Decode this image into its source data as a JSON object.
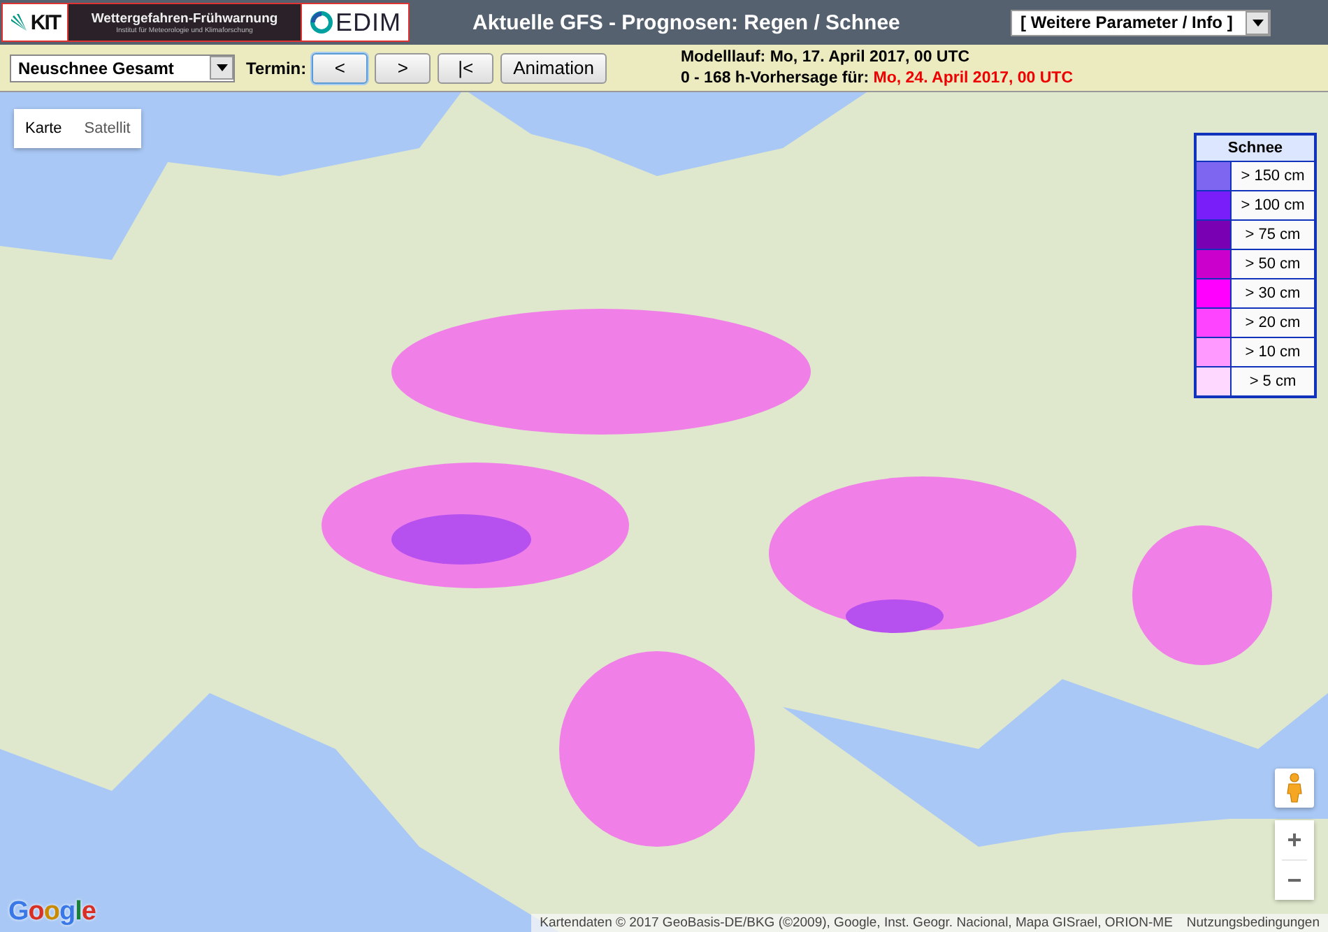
{
  "header": {
    "logos": {
      "kit": "KIT",
      "banner_title": "Wettergefahren-Frühwarnung",
      "banner_subtitle": "Institut für Meteorologie und Klimaforschung",
      "cedim": "EDIM"
    },
    "title": "Aktuelle GFS - Prognosen: Regen / Schnee",
    "parameter_dropdown": "[ Weitere Parameter / Info ]"
  },
  "toolbar": {
    "product_dropdown": "Neuschnee Gesamt",
    "termin_label": "Termin:",
    "buttons": [
      {
        "label": "<",
        "selected": true
      },
      {
        "label": ">",
        "selected": false
      },
      {
        "label": "|<",
        "selected": false
      },
      {
        "label": "Animation",
        "selected": false
      }
    ],
    "model_run": "Modelllauf: Mo, 17. April 2017, 00 UTC",
    "forecast_label": "0 - 168 h-Vorhersage für:",
    "forecast_value": "Mo, 24. April 2017, 00 UTC"
  },
  "map": {
    "map_types": [
      {
        "label": "Karte",
        "selected": true
      },
      {
        "label": "Satellit",
        "selected": false
      }
    ],
    "legend": {
      "title": "Schnee",
      "items": [
        {
          "label": "> 150 cm",
          "color": "#7f66f0"
        },
        {
          "label": "> 100 cm",
          "color": "#7a1ef9"
        },
        {
          "label": "> 75 cm",
          "color": "#7a00b4"
        },
        {
          "label": "> 50 cm",
          "color": "#cc00cc"
        },
        {
          "label": "> 30 cm",
          "color": "#ff00ff"
        },
        {
          "label": "> 20 cm",
          "color": "#ff44ff"
        },
        {
          "label": "> 10 cm",
          "color": "#ff99ff"
        },
        {
          "label": "> 5 cm",
          "color": "#ffd8ff"
        }
      ]
    },
    "zoom_in": "+",
    "zoom_out": "−",
    "google_logo": "Google",
    "attribution": "Kartendaten © 2017 GeoBasis-DE/BKG (©2009), Google, Inst. Geogr. Nacional, Mapa GISrael, ORION-ME",
    "terms_link": "Nutzungsbedingungen"
  }
}
